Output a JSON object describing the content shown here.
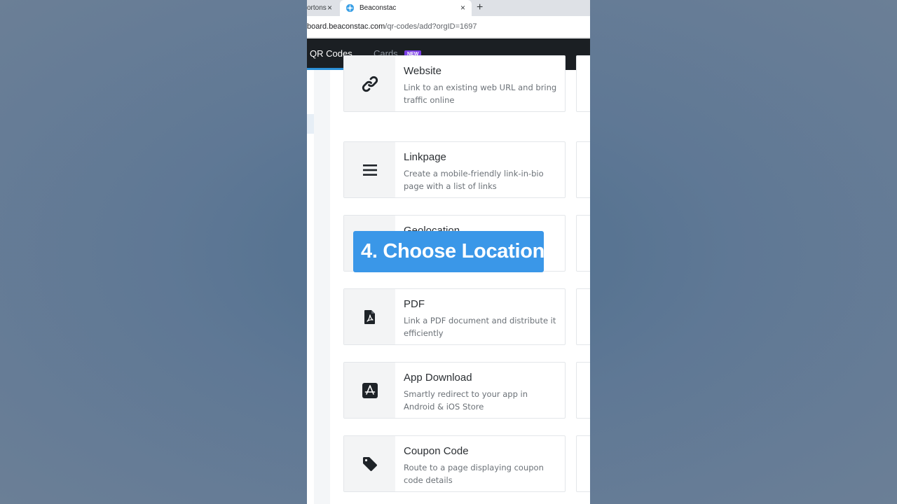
{
  "browser": {
    "inactive_tab_title": "ortons",
    "inactive_tab_close": "×",
    "active_tab_title": "Beaconstac",
    "active_tab_close": "×",
    "new_tab": "+",
    "url_host": "board.beaconstac.com",
    "url_path": "/qr-codes/add?orgID=1697"
  },
  "nav": {
    "qr_codes": "QR Codes",
    "cards": "Cards",
    "cards_badge": "NEW"
  },
  "cards": [
    {
      "title": "Website",
      "description": "Link to an existing web URL and bring traffic online",
      "icon": "link-icon"
    },
    {
      "title": "Linkpage",
      "description": "Create a mobile-friendly link-in-bio page with a list of links",
      "icon": "menu-icon"
    },
    {
      "title": "Geolocation",
      "description": "",
      "icon": "location-icon"
    },
    {
      "title": "PDF",
      "description": "Link a PDF document and distribute it efficiently",
      "icon": "pdf-icon"
    },
    {
      "title": "App Download",
      "description": "Smartly redirect to your app in Android & iOS Store",
      "icon": "app-store-icon"
    },
    {
      "title": "Coupon Code",
      "description": "Route to a page displaying coupon code details",
      "icon": "tag-icon"
    }
  ],
  "overlay": {
    "label": "4. Choose Location"
  },
  "colors": {
    "nav_bg": "#1b1f23",
    "accent_blue": "#2b8fd6",
    "badge_purple": "#7b3fe4",
    "overlay_blue": "#3a97e8"
  }
}
